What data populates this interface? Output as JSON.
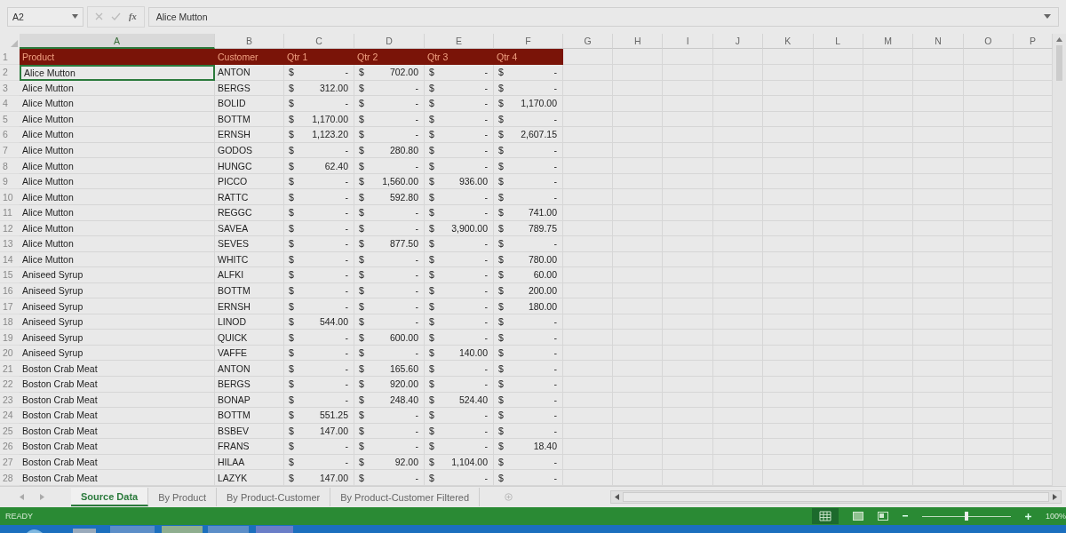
{
  "formula_bar": {
    "name_box": "A2",
    "function_label": "fx",
    "content": "Alice Mutton"
  },
  "columns": [
    {
      "label": "A",
      "selected": true
    },
    {
      "label": "B",
      "selected": false
    },
    {
      "label": "C",
      "selected": false
    },
    {
      "label": "D",
      "selected": false
    },
    {
      "label": "E",
      "selected": false
    },
    {
      "label": "F",
      "selected": false
    },
    {
      "label": "G",
      "selected": false
    },
    {
      "label": "H",
      "selected": false
    },
    {
      "label": "I",
      "selected": false
    },
    {
      "label": "J",
      "selected": false
    },
    {
      "label": "K",
      "selected": false
    },
    {
      "label": "L",
      "selected": false
    },
    {
      "label": "M",
      "selected": false
    },
    {
      "label": "N",
      "selected": false
    },
    {
      "label": "O",
      "selected": false
    },
    {
      "label": "P",
      "selected": false
    }
  ],
  "header_row": {
    "number": "1",
    "cells": [
      "Product",
      "Customer",
      "Qtr 1",
      "Qtr 2",
      "Qtr 3",
      "Qtr 4"
    ]
  },
  "rows": [
    {
      "number": "2",
      "product": "Alice Mutton",
      "customer": "ANTON",
      "selected": true,
      "quarters": [
        [
          "$",
          "-"
        ],
        [
          "$",
          "702.00"
        ],
        [
          "$",
          "-"
        ],
        [
          "$",
          "-"
        ]
      ]
    },
    {
      "number": "3",
      "product": "Alice Mutton",
      "customer": "BERGS",
      "selected": false,
      "quarters": [
        [
          "$",
          "312.00"
        ],
        [
          "$",
          "-"
        ],
        [
          "$",
          "-"
        ],
        [
          "$",
          "-"
        ]
      ]
    },
    {
      "number": "4",
      "product": "Alice Mutton",
      "customer": "BOLID",
      "selected": false,
      "quarters": [
        [
          "$",
          "-"
        ],
        [
          "$",
          "-"
        ],
        [
          "$",
          "-"
        ],
        [
          "$",
          "1,170.00"
        ]
      ]
    },
    {
      "number": "5",
      "product": "Alice Mutton",
      "customer": "BOTTM",
      "selected": false,
      "quarters": [
        [
          "$",
          "1,170.00"
        ],
        [
          "$",
          "-"
        ],
        [
          "$",
          "-"
        ],
        [
          "$",
          "-"
        ]
      ]
    },
    {
      "number": "6",
      "product": "Alice Mutton",
      "customer": "ERNSH",
      "selected": false,
      "quarters": [
        [
          "$",
          "1,123.20"
        ],
        [
          "$",
          "-"
        ],
        [
          "$",
          "-"
        ],
        [
          "$",
          "2,607.15"
        ]
      ]
    },
    {
      "number": "7",
      "product": "Alice Mutton",
      "customer": "GODOS",
      "selected": false,
      "quarters": [
        [
          "$",
          "-"
        ],
        [
          "$",
          "280.80"
        ],
        [
          "$",
          "-"
        ],
        [
          "$",
          "-"
        ]
      ]
    },
    {
      "number": "8",
      "product": "Alice Mutton",
      "customer": "HUNGC",
      "selected": false,
      "quarters": [
        [
          "$",
          "62.40"
        ],
        [
          "$",
          "-"
        ],
        [
          "$",
          "-"
        ],
        [
          "$",
          "-"
        ]
      ]
    },
    {
      "number": "9",
      "product": "Alice Mutton",
      "customer": "PICCO",
      "selected": false,
      "quarters": [
        [
          "$",
          "-"
        ],
        [
          "$",
          "1,560.00"
        ],
        [
          "$",
          "936.00"
        ],
        [
          "$",
          "-"
        ]
      ]
    },
    {
      "number": "10",
      "product": "Alice Mutton",
      "customer": "RATTC",
      "selected": false,
      "quarters": [
        [
          "$",
          "-"
        ],
        [
          "$",
          "592.80"
        ],
        [
          "$",
          "-"
        ],
        [
          "$",
          "-"
        ]
      ]
    },
    {
      "number": "11",
      "product": "Alice Mutton",
      "customer": "REGGC",
      "selected": false,
      "quarters": [
        [
          "$",
          "-"
        ],
        [
          "$",
          "-"
        ],
        [
          "$",
          "-"
        ],
        [
          "$",
          "741.00"
        ]
      ]
    },
    {
      "number": "12",
      "product": "Alice Mutton",
      "customer": "SAVEA",
      "selected": false,
      "quarters": [
        [
          "$",
          "-"
        ],
        [
          "$",
          "-"
        ],
        [
          "$",
          "3,900.00"
        ],
        [
          "$",
          "789.75"
        ]
      ]
    },
    {
      "number": "13",
      "product": "Alice Mutton",
      "customer": "SEVES",
      "selected": false,
      "quarters": [
        [
          "$",
          "-"
        ],
        [
          "$",
          "877.50"
        ],
        [
          "$",
          "-"
        ],
        [
          "$",
          "-"
        ]
      ]
    },
    {
      "number": "14",
      "product": "Alice Mutton",
      "customer": "WHITC",
      "selected": false,
      "quarters": [
        [
          "$",
          "-"
        ],
        [
          "$",
          "-"
        ],
        [
          "$",
          "-"
        ],
        [
          "$",
          "780.00"
        ]
      ]
    },
    {
      "number": "15",
      "product": "Aniseed Syrup",
      "customer": "ALFKI",
      "selected": false,
      "quarters": [
        [
          "$",
          "-"
        ],
        [
          "$",
          "-"
        ],
        [
          "$",
          "-"
        ],
        [
          "$",
          "60.00"
        ]
      ]
    },
    {
      "number": "16",
      "product": "Aniseed Syrup",
      "customer": "BOTTM",
      "selected": false,
      "quarters": [
        [
          "$",
          "-"
        ],
        [
          "$",
          "-"
        ],
        [
          "$",
          "-"
        ],
        [
          "$",
          "200.00"
        ]
      ]
    },
    {
      "number": "17",
      "product": "Aniseed Syrup",
      "customer": "ERNSH",
      "selected": false,
      "quarters": [
        [
          "$",
          "-"
        ],
        [
          "$",
          "-"
        ],
        [
          "$",
          "-"
        ],
        [
          "$",
          "180.00"
        ]
      ]
    },
    {
      "number": "18",
      "product": "Aniseed Syrup",
      "customer": "LINOD",
      "selected": false,
      "quarters": [
        [
          "$",
          "544.00"
        ],
        [
          "$",
          "-"
        ],
        [
          "$",
          "-"
        ],
        [
          "$",
          "-"
        ]
      ]
    },
    {
      "number": "19",
      "product": "Aniseed Syrup",
      "customer": "QUICK",
      "selected": false,
      "quarters": [
        [
          "$",
          "-"
        ],
        [
          "$",
          "600.00"
        ],
        [
          "$",
          "-"
        ],
        [
          "$",
          "-"
        ]
      ]
    },
    {
      "number": "20",
      "product": "Aniseed Syrup",
      "customer": "VAFFE",
      "selected": false,
      "quarters": [
        [
          "$",
          "-"
        ],
        [
          "$",
          "-"
        ],
        [
          "$",
          "140.00"
        ],
        [
          "$",
          "-"
        ]
      ]
    },
    {
      "number": "21",
      "product": "Boston Crab Meat",
      "customer": "ANTON",
      "selected": false,
      "quarters": [
        [
          "$",
          "-"
        ],
        [
          "$",
          "165.60"
        ],
        [
          "$",
          "-"
        ],
        [
          "$",
          "-"
        ]
      ]
    },
    {
      "number": "22",
      "product": "Boston Crab Meat",
      "customer": "BERGS",
      "selected": false,
      "quarters": [
        [
          "$",
          "-"
        ],
        [
          "$",
          "920.00"
        ],
        [
          "$",
          "-"
        ],
        [
          "$",
          "-"
        ]
      ]
    },
    {
      "number": "23",
      "product": "Boston Crab Meat",
      "customer": "BONAP",
      "selected": false,
      "quarters": [
        [
          "$",
          "-"
        ],
        [
          "$",
          "248.40"
        ],
        [
          "$",
          "524.40"
        ],
        [
          "$",
          "-"
        ]
      ]
    },
    {
      "number": "24",
      "product": "Boston Crab Meat",
      "customer": "BOTTM",
      "selected": false,
      "quarters": [
        [
          "$",
          "551.25"
        ],
        [
          "$",
          "-"
        ],
        [
          "$",
          "-"
        ],
        [
          "$",
          "-"
        ]
      ]
    },
    {
      "number": "25",
      "product": "Boston Crab Meat",
      "customer": "BSBEV",
      "selected": false,
      "quarters": [
        [
          "$",
          "147.00"
        ],
        [
          "$",
          "-"
        ],
        [
          "$",
          "-"
        ],
        [
          "$",
          "-"
        ]
      ]
    },
    {
      "number": "26",
      "product": "Boston Crab Meat",
      "customer": "FRANS",
      "selected": false,
      "quarters": [
        [
          "$",
          "-"
        ],
        [
          "$",
          "-"
        ],
        [
          "$",
          "-"
        ],
        [
          "$",
          "18.40"
        ]
      ]
    },
    {
      "number": "27",
      "product": "Boston Crab Meat",
      "customer": "HILAA",
      "selected": false,
      "quarters": [
        [
          "$",
          "-"
        ],
        [
          "$",
          "92.00"
        ],
        [
          "$",
          "1,104.00"
        ],
        [
          "$",
          "-"
        ]
      ]
    },
    {
      "number": "28",
      "product": "Boston Crab Meat",
      "customer": "LAZYK",
      "selected": false,
      "quarters": [
        [
          "$",
          "147.00"
        ],
        [
          "$",
          "-"
        ],
        [
          "$",
          "-"
        ],
        [
          "$",
          "-"
        ]
      ]
    }
  ],
  "sheet_tabs": [
    {
      "label": "Source Data",
      "selected": true
    },
    {
      "label": "By Product",
      "selected": false
    },
    {
      "label": "By Product-Customer",
      "selected": false
    },
    {
      "label": "By Product-Customer Filtered",
      "selected": false
    }
  ],
  "status_bar": {
    "status": "READY",
    "zoom": {
      "level": 0.5,
      "reading": "100%"
    }
  }
}
